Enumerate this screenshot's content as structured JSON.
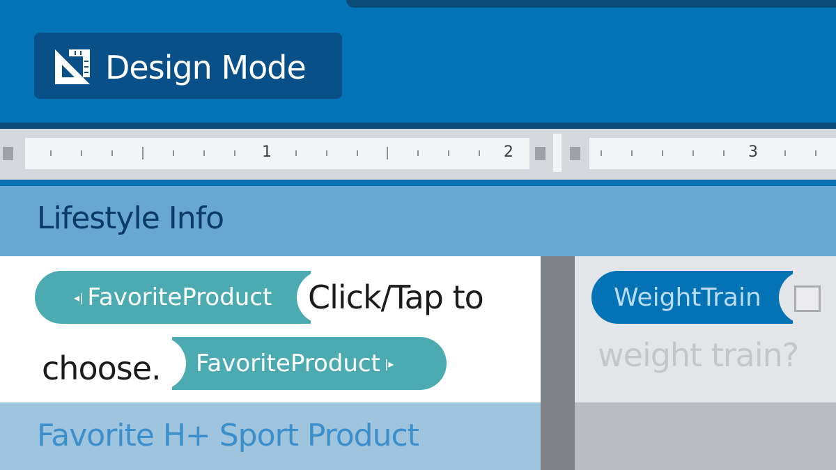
{
  "ribbon": {
    "design_mode_label": "Design Mode",
    "design_mode_icon": "set-square-ruler-icon"
  },
  "ruler": {
    "numbers": [
      "1",
      "2",
      "3"
    ]
  },
  "section": {
    "title": "Lifestyle Info"
  },
  "document": {
    "content_control_start": "FavoriteProduct",
    "placeholder_text_line1": "Click/Tap to",
    "placeholder_text_line2": "choose.",
    "content_control_end": "FavoriteProduct",
    "next_heading": "Favorite H+ Sport Product"
  },
  "side_panel": {
    "content_control": "WeightTrain",
    "checkbox_checked": false,
    "question": "weight train?"
  },
  "colors": {
    "ribbon_blue": "#0473b5",
    "tag_teal": "#4cabb1",
    "section_blue": "#67a7d0"
  }
}
